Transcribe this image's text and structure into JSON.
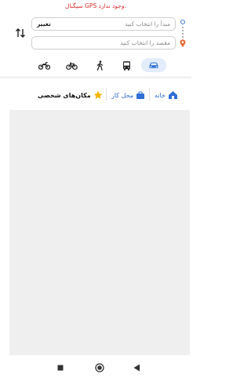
{
  "gps_banner": {
    "text": "سیگنال GPS وجود ندارد.",
    "color": "#d62b2b"
  },
  "route": {
    "origin_placeholder": "مبدأ را انتخاب کنید",
    "origin_action": "تغییر",
    "destination_placeholder": "مقصد را انتخاب کنید",
    "swap_icon": "swap-vertical-icon"
  },
  "modes": [
    {
      "name": "car",
      "icon": "car-icon",
      "active": true
    },
    {
      "name": "bus",
      "icon": "bus-icon",
      "active": false
    },
    {
      "name": "walk",
      "icon": "walk-icon",
      "active": false
    },
    {
      "name": "bicycle",
      "icon": "bicycle-icon",
      "active": false
    },
    {
      "name": "motorcycle",
      "icon": "motorcycle-icon",
      "active": false
    }
  ],
  "places": {
    "home_label": "خانه",
    "work_label": "محل کار",
    "personal_label": "مکان‌های شخصی"
  },
  "colors": {
    "accent": "#2f6fd6",
    "active_mode_bg": "#e2ecfb",
    "star": "#f4b400",
    "map_bg": "#efefef"
  },
  "navbar": {
    "icons": [
      "square-recents-icon",
      "circle-home-icon",
      "triangle-back-icon"
    ]
  }
}
